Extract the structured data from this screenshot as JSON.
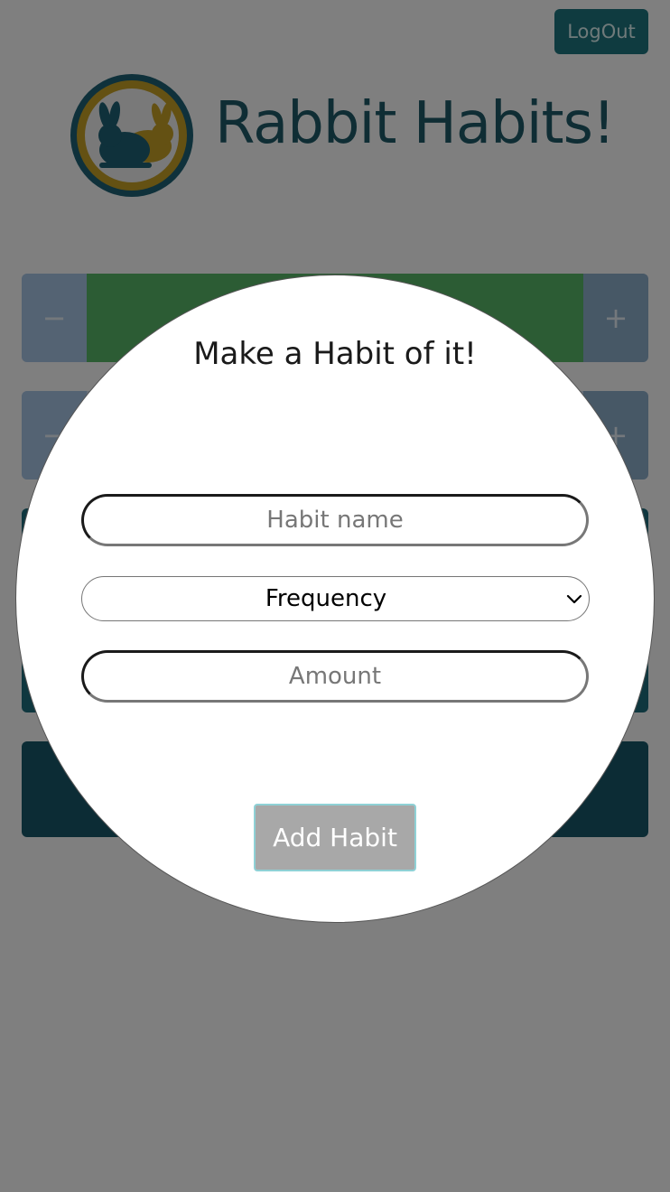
{
  "header": {
    "logout_label": "LogOut",
    "app_title": "Rabbit Habits!",
    "logo_icon": "rabbit-logo-icon"
  },
  "habits": {
    "rows": [
      {
        "minus_label": "−",
        "plus_label": "+",
        "progress": 1.0
      },
      {
        "minus_label": "−",
        "plus_label": "+",
        "progress": 0.0
      }
    ]
  },
  "modal": {
    "title": "Make a Habit of it!",
    "name_placeholder": "Habit name",
    "frequency_selected": "Frequency",
    "amount_placeholder": "Amount",
    "add_button_label": "Add Habit"
  },
  "colors": {
    "brand_teal": "#1e5a68",
    "logo_gold": "#c9a227",
    "progress_green": "#58b868",
    "button_accent": "#8fd1d6"
  }
}
